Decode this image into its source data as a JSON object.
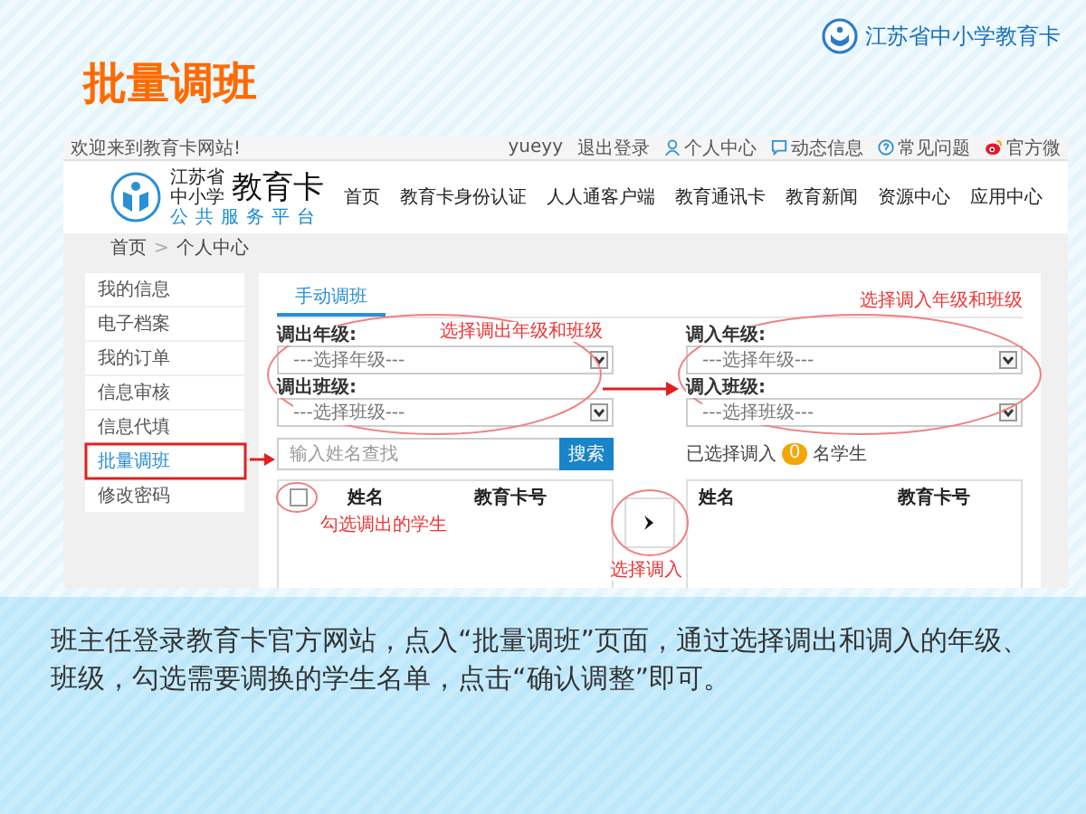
{
  "slide": {
    "title": "批量调班",
    "brand": "江苏省中小学教育卡",
    "caption": "班主任登录教育卡官方网站，点入“批量调班”页面，通过选择调出和调入的年级、班级，勾选需要调换的学生名单，点击“确认调整”即可。"
  },
  "site": {
    "welcome": "欢迎来到教育卡网站!",
    "user": "yueyy",
    "logout": "退出登录",
    "top_links": [
      {
        "label": "个人中心",
        "kind": "user"
      },
      {
        "label": "动态信息",
        "kind": "message"
      },
      {
        "label": "常见问题",
        "kind": "help"
      },
      {
        "label": "官方微",
        "kind": "social"
      }
    ],
    "logo": {
      "line_1": "江苏省",
      "line_2": "中小学",
      "name": "教育卡",
      "subtitle": "公共服务平台"
    },
    "nav": [
      "首页",
      "教育卡身份认证",
      "人人通客户端",
      "教育通讯卡",
      "教育新闻",
      "资源中心",
      "应用中心"
    ],
    "breadcrumb": {
      "items": [
        "首页",
        "个人中心"
      ],
      "separator": ">"
    },
    "sidebar": [
      {
        "label": "我的信息",
        "selected": false
      },
      {
        "label": "电子档案",
        "selected": false
      },
      {
        "label": "我的订单",
        "selected": false
      },
      {
        "label": "信息审核",
        "selected": false
      },
      {
        "label": "信息代填",
        "selected": false
      },
      {
        "label": "批量调班",
        "selected": true
      },
      {
        "label": "修改密码",
        "selected": false
      }
    ],
    "tab": {
      "label": "手动调班",
      "selected": true
    },
    "transfer_out": {
      "grade_label": "调出年级:",
      "grade_select": "---选择年级---",
      "class_label": "调出班级:",
      "class_select": "---选择班级---"
    },
    "transfer_in": {
      "grade_label": "调入年级:",
      "grade_select": "---选择年级---",
      "class_label": "调入班级:",
      "class_select": "---选择班级---"
    },
    "search": {
      "placeholder": "输入姓名查找",
      "button": "搜索"
    },
    "selected_count": {
      "prefix": "已选择调入",
      "count": "0",
      "suffix": "名学生"
    },
    "out_list": {
      "checked": false,
      "columns": [
        "姓名",
        "教育卡号"
      ]
    },
    "in_list": {
      "columns": [
        "姓名",
        "教育卡号"
      ]
    }
  },
  "annotations": [
    "选择调出年级和班级",
    "选择调入年级和班级",
    "勾选调出的学生",
    "选择调入"
  ]
}
